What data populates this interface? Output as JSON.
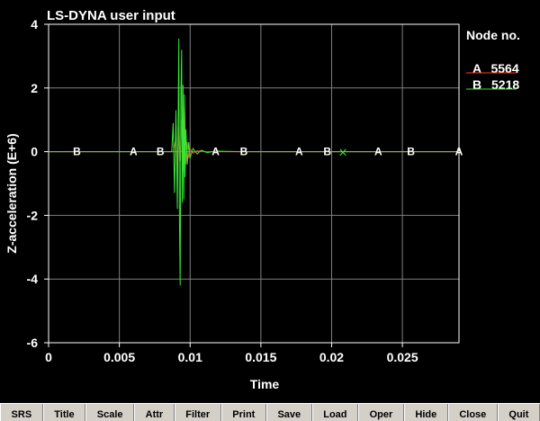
{
  "window": {
    "title": "LS-DYNA user input"
  },
  "legend": {
    "header": "Node no.",
    "entries": [
      {
        "marker": "A",
        "label": "5564",
        "color": "#ff3b1f"
      },
      {
        "marker": "B",
        "label": "5218",
        "color": "#35e635"
      }
    ]
  },
  "toolbar": {
    "buttons": [
      "SRS",
      "Title",
      "Scale",
      "Attr",
      "Filter",
      "Print",
      "Save",
      "Load",
      "Oper",
      "Hide",
      "Close",
      "Quit"
    ]
  },
  "colors": {
    "background": "#000000",
    "axes": "#ffffff",
    "grid": "#808080",
    "series_a": "#ff3b1f",
    "series_b": "#35e635"
  },
  "chart_data": {
    "type": "line",
    "title": "LS-DYNA user input",
    "xlabel": "Time",
    "ylabel": "Z-acceleration (E+6)",
    "xlim": [
      0,
      0.029
    ],
    "ylim": [
      -6,
      4
    ],
    "grid": true,
    "legend_position": "right",
    "x_ticks": [
      0,
      0.005,
      0.01,
      0.015,
      0.02,
      0.025
    ],
    "x_tick_labels": [
      "0",
      "0.005",
      "0.01",
      "0.015",
      "0.02",
      "0.025"
    ],
    "y_ticks": [
      -6,
      -4,
      -2,
      0,
      2,
      4
    ],
    "y_tick_labels": [
      "-6",
      "-4",
      "-2",
      "0",
      "2",
      "4"
    ],
    "series": [
      {
        "name": "5564",
        "marker": "A",
        "x": [
          0,
          0.0088,
          0.009,
          0.0091,
          0.0092,
          0.0093,
          0.0094,
          0.0095,
          0.0096,
          0.0097,
          0.0098,
          0.0099,
          0.01,
          0.0102,
          0.0105,
          0.011,
          0.029
        ],
        "y": [
          0,
          0,
          0.4,
          -0.5,
          0.8,
          -0.3,
          1.0,
          -0.6,
          1.5,
          -0.4,
          0.3,
          -0.2,
          0.1,
          -0.05,
          0.03,
          0,
          0
        ],
        "marker_x": [
          0.006,
          0.0118,
          0.0177,
          0.0233,
          0.029
        ]
      },
      {
        "name": "5218",
        "marker": "B",
        "x": [
          0,
          0.0087,
          0.0088,
          0.0089,
          0.009,
          0.0091,
          0.0092,
          0.00925,
          0.0093,
          0.00935,
          0.0094,
          0.00945,
          0.0095,
          0.00955,
          0.0096,
          0.00965,
          0.0097,
          0.0098,
          0.0099,
          0.01,
          0.0102,
          0.0105,
          0.0108,
          0.0112,
          0.0118,
          0.0125,
          0.0135,
          0.015,
          0.029
        ],
        "y": [
          0,
          0,
          0.9,
          -1.3,
          1.3,
          -1.8,
          3.55,
          -2.2,
          -4.2,
          1.8,
          3.2,
          -1.6,
          2.1,
          -1.5,
          1.8,
          -0.8,
          0.7,
          -0.4,
          0.3,
          -0.2,
          0.1,
          -0.07,
          0.05,
          -0.03,
          0.02,
          0.01,
          0,
          0,
          0
        ],
        "marker_x": [
          0.002,
          0.0079,
          0.0138,
          0.0197,
          0.0256
        ]
      }
    ],
    "annotations": [
      {
        "symbol": "×",
        "x": 0.0208,
        "y": 0
      }
    ]
  }
}
